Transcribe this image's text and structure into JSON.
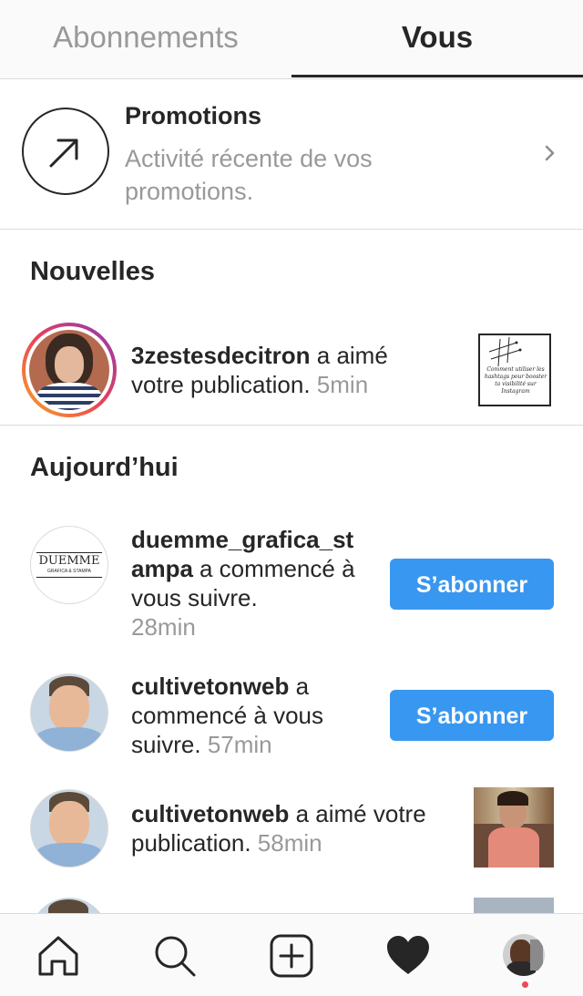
{
  "tabs": {
    "following": "Abonnements",
    "you": "Vous"
  },
  "promotions": {
    "title": "Promotions",
    "description": "Activité récente de vos promotions."
  },
  "sections": {
    "new": "Nouvelles",
    "today": "Aujourd’hui"
  },
  "notifications_new": [
    {
      "username": "3zestesdecitron",
      "action": "a aimé votre publication.",
      "time": "5min"
    }
  ],
  "notifications_today": [
    {
      "username": "duemme_grafica_st ampa",
      "action": "a commencé à vous suivre.",
      "time": "28min",
      "button": "S’abonner"
    },
    {
      "username": "cultivetonweb",
      "action": "a commencé à vous suivre.",
      "time": "57min",
      "button": "S’abonner"
    },
    {
      "username": "cultivetonweb",
      "action": "a aimé votre publication.",
      "time": "58min"
    }
  ],
  "avatar_logo_text": {
    "name": "DUEMME",
    "sub": "GRAFICA & STAMPA"
  },
  "thumbnail_caption": "Comment utiliser les hashtags pour booster ta visibilité sur Instagram",
  "nav": [
    "home-icon",
    "search-icon",
    "add-post-icon",
    "activity-heart-icon",
    "profile-avatar-icon"
  ],
  "colors": {
    "accent": "#3897f0",
    "muted": "#999999",
    "text": "#262626",
    "badge": "#ed4956"
  }
}
